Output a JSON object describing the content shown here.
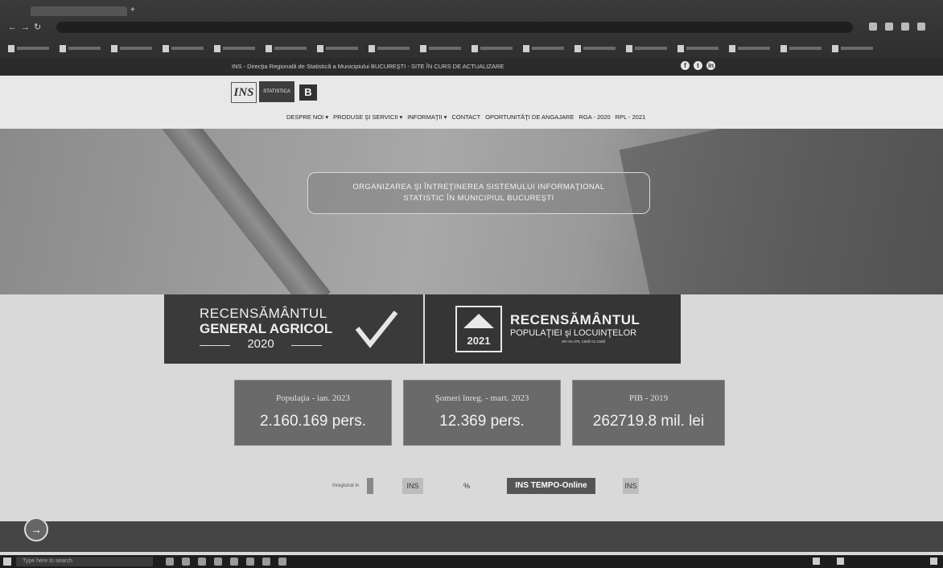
{
  "browser": {
    "url": "",
    "bookmarks_count": 17
  },
  "site": {
    "notice": "INS - Direcţia Regională de Statistică a Municipiului BUCUREŞTI - SITE ÎN CURS DE ACTUALIZARE",
    "social": [
      "f",
      "t",
      "in"
    ],
    "logos": {
      "ins": "INS",
      "stat": "STATISTICA",
      "b": "B"
    },
    "menu": [
      "DESPRE NOI ▾",
      "PRODUSE ŞI SERVICII ▾",
      "INFORMAŢII ▾",
      "CONTACT",
      "OPORTUNITĂŢI DE ANGAJARE",
      "RGA - 2020",
      "RPL - 2021"
    ],
    "hero_line1": "ORGANIZAREA ŞI ÎNTREŢINEREA SISTEMULUI INFORMAŢIONAL",
    "hero_line2": "STATISTIC ÎN MUNICIPIUL BUCUREŞTI",
    "rga": {
      "line1": "RECENSĂMÂNTUL",
      "line2": "GENERAL AGRICOL",
      "line3": "2020"
    },
    "rpl": {
      "year": "2021",
      "line1": "RECENSĂMÂNTUL",
      "line2": "POPULAŢIEI şi LOCUINŢELOR",
      "tag": "am eu om, casă cu casă"
    },
    "stats": [
      {
        "label": "Populaţia - ian. 2023",
        "value": "2.160.169 pers."
      },
      {
        "label": "Şomeri înreg. - mart. 2023",
        "value": "12.369 pers."
      },
      {
        "label": "PIB - 2019",
        "value": "262719.8 mil. lei"
      }
    ],
    "partners_text": "înregistrat în",
    "partners": [
      "INS",
      "INS",
      "%",
      "INS TEMPO-Online",
      "INS"
    ],
    "back_button": "→"
  },
  "taskbar": {
    "search_placeholder": "Type here to search"
  },
  "colors": {
    "chrome": "#2c2c2c",
    "banner": "#3a3a3a",
    "stat_box": "#6a6a6a"
  }
}
